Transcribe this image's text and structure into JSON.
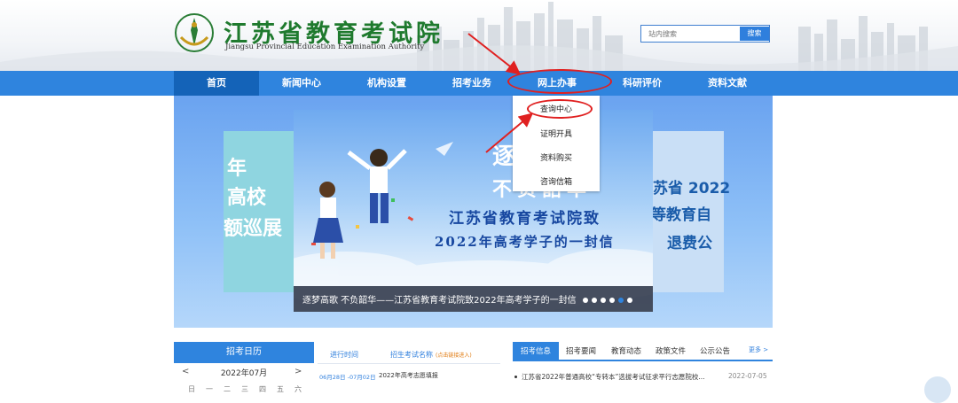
{
  "header": {
    "title": "江苏省教育考试院",
    "subtitle": "Jiangsu Provincial Education Examination Authority",
    "search_placeholder": "站内搜索",
    "search_button": "搜索"
  },
  "nav": {
    "items": [
      "首页",
      "新闻中心",
      "机构设置",
      "招考业务",
      "网上办事",
      "科研评价",
      "资料文献"
    ],
    "active": "首页"
  },
  "dropdown": {
    "items": [
      "查询中心",
      "证明开具",
      "资料购买",
      "咨询信箱"
    ]
  },
  "banner": {
    "left_lines": [
      "年",
      "高校",
      "额巡展"
    ],
    "right_lines": [
      "苏省 2022",
      "等教育自",
      "退费公"
    ],
    "slide_big1": "逐",
    "slide_big2": "不负韶华",
    "slide_heading1": "江苏省教育考试院致",
    "slide_heading2": "2022年高考学子的一封信",
    "caption": "逐梦高歌 不负韶华——江苏省教育考试院致2022年高考学子的一封信",
    "slide_count": 6,
    "active_slide": 5
  },
  "calendar": {
    "title": "招考日历",
    "month": "2022年07月",
    "prev": "<",
    "next": ">",
    "weekdays": [
      "日",
      "一",
      "二",
      "三",
      "四",
      "五",
      "六"
    ]
  },
  "exam_schedule": {
    "col_time": "进行时间",
    "col_name": "招生考试名称",
    "col_name_hint": "(点击链接进入)",
    "rows": [
      {
        "time": "06月28日 -07月02日",
        "name": "2022年高考志愿填报"
      }
    ]
  },
  "news": {
    "tabs": [
      "招考信息",
      "招考要闻",
      "教育动态",
      "政策文件",
      "公示公告"
    ],
    "active_tab": "招考信息",
    "more": "更多 >",
    "items": [
      {
        "title": "江苏省2022年普通高校“专转本”选拔考试征求平行志愿院校...",
        "date": "2022-07-05"
      }
    ]
  },
  "colors": {
    "nav_blue": "#2f84de",
    "nav_active": "#1463b8",
    "title_green": "#1f7a2e",
    "annotation_red": "#e02020"
  }
}
